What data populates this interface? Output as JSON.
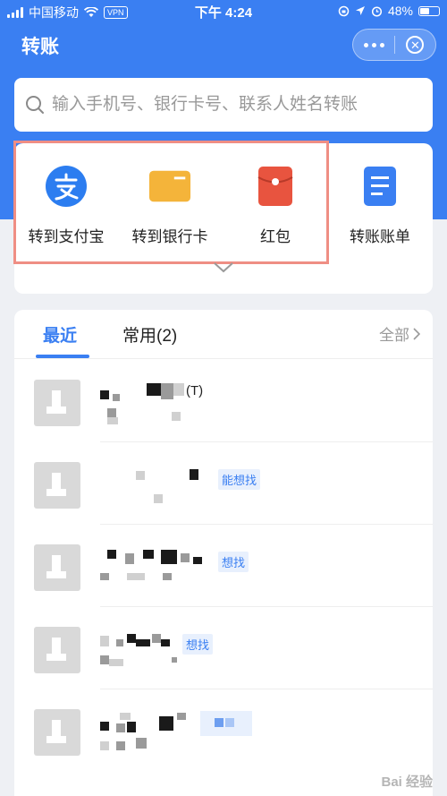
{
  "status_bar": {
    "carrier": "中国移动",
    "vpn": "VPN",
    "time": "下午 4:24",
    "battery": "48%"
  },
  "nav": {
    "title": "转账"
  },
  "search": {
    "placeholder": "输入手机号、银行卡号、联系人姓名转账"
  },
  "actions": [
    {
      "label": "转到支付宝",
      "icon": "alipay-icon",
      "color": "#2c7df0"
    },
    {
      "label": "转到银行卡",
      "icon": "bank-card-icon",
      "color": "#f4b43a"
    },
    {
      "label": "红包",
      "icon": "red-packet-icon",
      "color": "#e8543f"
    },
    {
      "label": "转账账单",
      "icon": "bill-icon",
      "color": "#3a7ff2"
    }
  ],
  "tabs": {
    "recent": "最近",
    "frequent": "常用(2)",
    "all": "全部"
  },
  "contacts": [
    {
      "suffix": "(T)",
      "tag": ""
    },
    {
      "suffix": "",
      "tag": "能想找"
    },
    {
      "suffix": "",
      "tag": "想找"
    },
    {
      "suffix": "",
      "tag": "想找"
    },
    {
      "suffix": "",
      "tag": ""
    }
  ],
  "watermark": "Bai 经验",
  "colors": {
    "primary": "#3a7ff2",
    "highlight_border": "#ef8e84"
  }
}
